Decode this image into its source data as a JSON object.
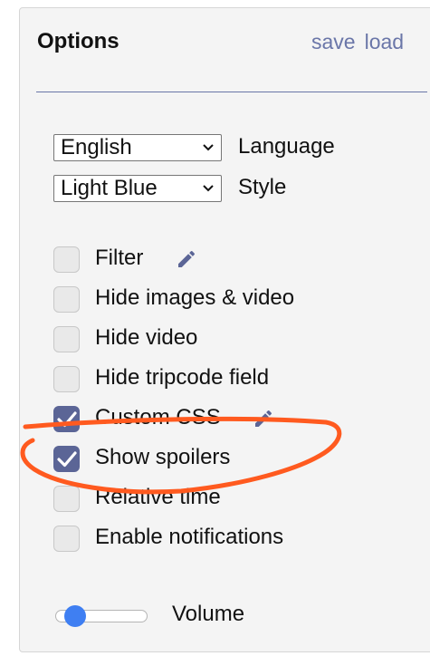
{
  "header": {
    "title": "Options",
    "save_label": "save",
    "load_label": "load"
  },
  "selects": {
    "language": {
      "value": "English",
      "label": "Language"
    },
    "style": {
      "value": "Light Blue",
      "label": "Style"
    }
  },
  "options": [
    {
      "label": "Filter",
      "checked": false,
      "edit_icon": "pencil-icon"
    },
    {
      "label": "Hide images & video",
      "checked": false
    },
    {
      "label": "Hide video",
      "checked": false
    },
    {
      "label": "Hide tripcode field",
      "checked": false
    },
    {
      "label": "Custom CSS",
      "checked": true,
      "edit_icon": "pencil-icon"
    },
    {
      "label": "Show spoilers",
      "checked": true
    },
    {
      "label": "Relative time",
      "checked": false
    },
    {
      "label": "Enable notifications",
      "checked": false
    }
  ],
  "volume": {
    "label": "Volume",
    "level": 0.15
  },
  "colors": {
    "accent": "#6a76a8",
    "checkbox_checked": "#5b6596",
    "slider_thumb": "#3f7ff2",
    "annotation": "#ff5a1f"
  }
}
